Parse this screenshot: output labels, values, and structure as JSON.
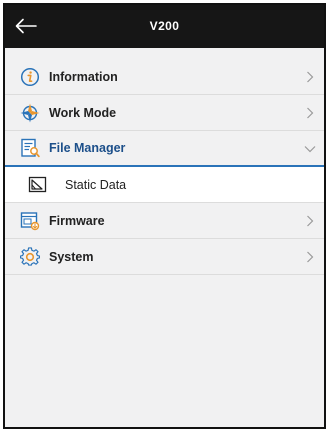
{
  "header": {
    "title": "V200",
    "back_icon": "back-arrow-icon"
  },
  "menu": {
    "information": {
      "label": "Information",
      "icon": "info-icon"
    },
    "work_mode": {
      "label": "Work Mode",
      "icon": "compass-icon"
    },
    "file_manager": {
      "label": "File Manager",
      "icon": "file-manager-icon",
      "expanded": true,
      "children": [
        {
          "label": "Static Data",
          "icon": "static-data-icon"
        }
      ]
    },
    "firmware": {
      "label": "Firmware",
      "icon": "firmware-icon"
    },
    "system": {
      "label": "System",
      "icon": "gear-icon"
    }
  },
  "colors": {
    "titlebar": "#161616",
    "background": "#f1f1f2",
    "accent": "#2a73b8",
    "icon_orange": "#e8962e",
    "icon_blue": "#2a73b8"
  }
}
